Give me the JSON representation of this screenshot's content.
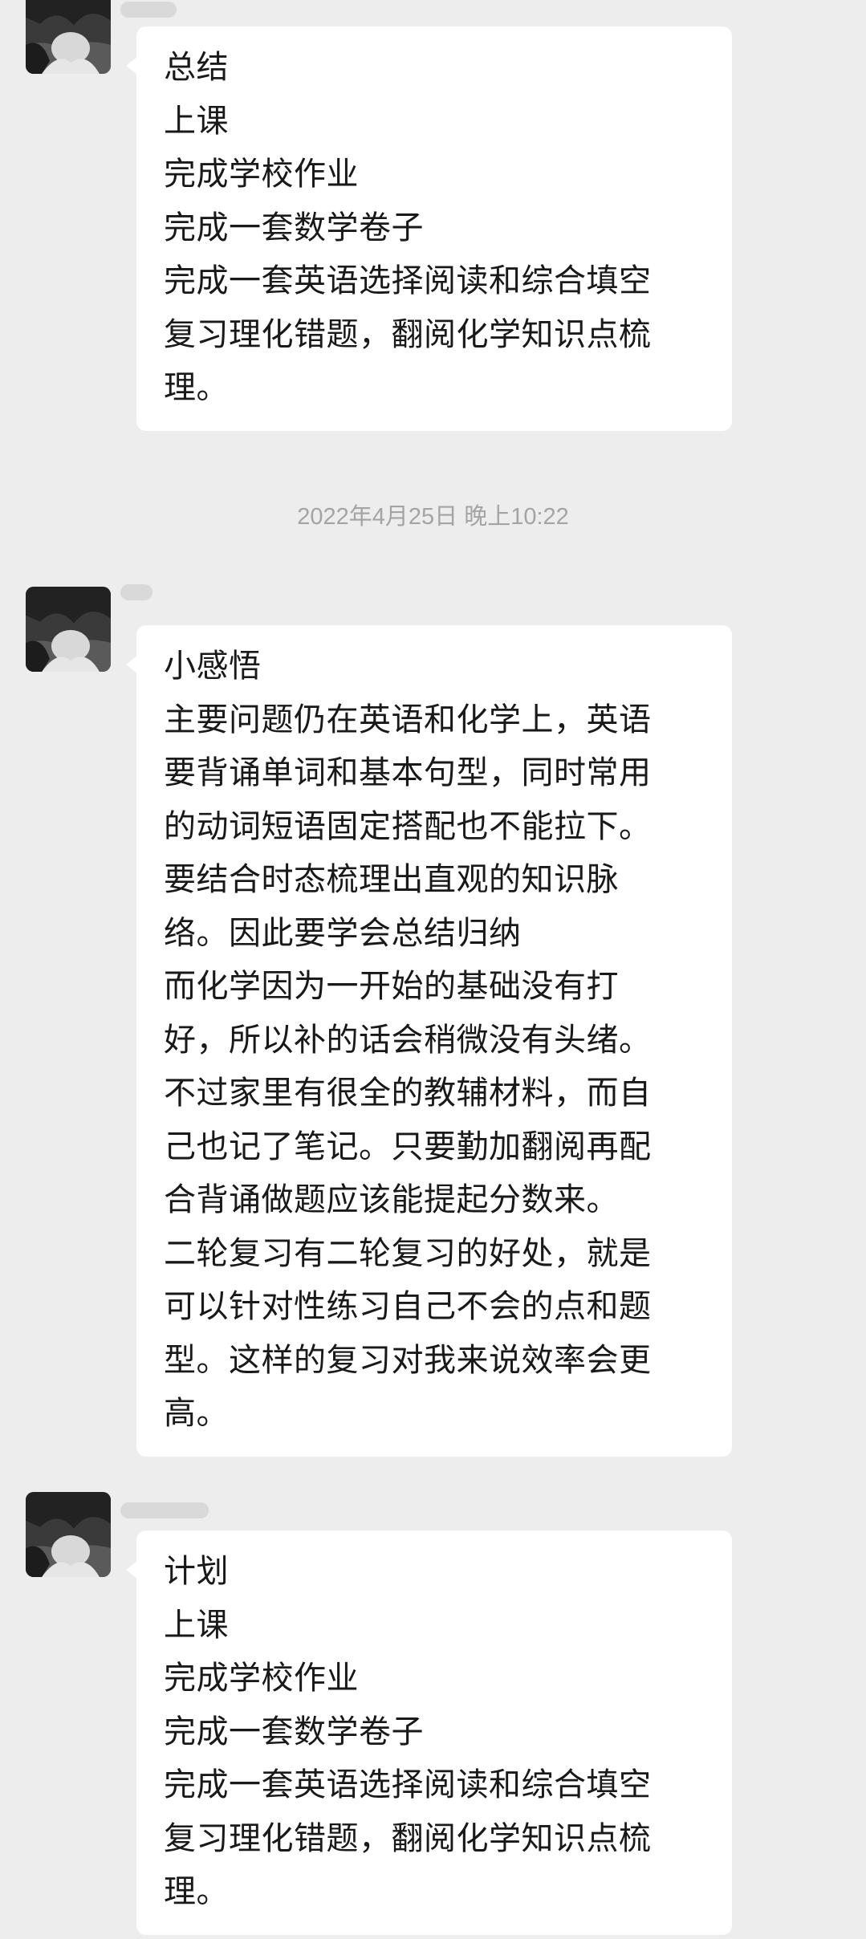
{
  "timestamp": "2022年4月25日 晚上10:22",
  "messages": [
    {
      "lines": [
        "总结",
        "上课",
        "完成学校作业",
        "完成一套数学卷子",
        "完成一套英语选择阅读和综合填空",
        "复习理化错题，翻阅化学知识点梳",
        "理。"
      ]
    },
    {
      "lines": [
        "小感悟",
        "主要问题仍在英语和化学上，英语",
        "要背诵单词和基本句型，同时常用",
        "的动词短语固定搭配也不能拉下。",
        "要结合时态梳理出直观的知识脉",
        "络。因此要学会总结归纳",
        "而化学因为一开始的基础没有打",
        "好，所以补的话会稍微没有头绪。",
        "不过家里有很全的教辅材料，而自",
        "己也记了笔记。只要勤加翻阅再配",
        "合背诵做题应该能提起分数来。",
        "二轮复习有二轮复习的好处，就是",
        "可以针对性练习自己不会的点和题",
        "型。这样的复习对我来说效率会更",
        "高。"
      ]
    },
    {
      "lines": [
        "计划",
        "上课",
        "完成学校作业",
        "完成一套数学卷子",
        "完成一套英语选择阅读和综合填空",
        "复习理化错题，翻阅化学知识点梳",
        "理。"
      ]
    }
  ]
}
